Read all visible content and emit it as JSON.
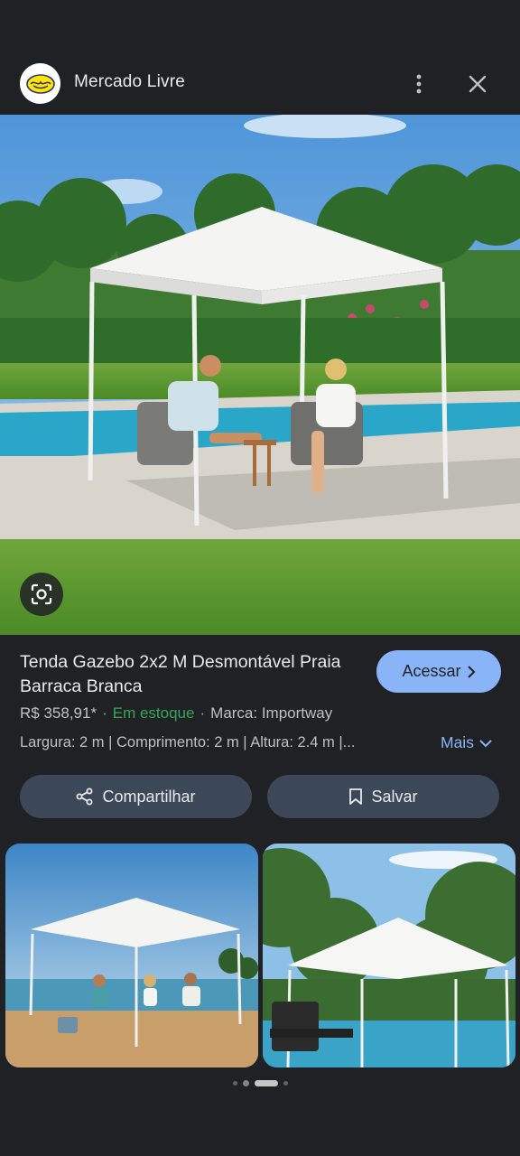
{
  "header": {
    "site_name": "Mercado Livre",
    "logo_icon": "mercado-livre-handshake-logo",
    "menu_icon": "more-vert-icon",
    "close_icon": "close-icon"
  },
  "hero": {
    "image": "white gazebo tent beside pool with two people seated",
    "lens_icon": "google-lens-icon"
  },
  "product": {
    "title": "Tenda Gazebo 2x2 M Desmontável Praia Barraca Branca",
    "price": "R$ 358,91*",
    "stock": "Em estoque",
    "brand": "Marca: Importway",
    "specs": "Largura: 2 m | Comprimento: 2 m | Altura: 2.4 m |...",
    "more_label": "Mais",
    "access_label": "Acessar"
  },
  "actions": {
    "share_label": "Compartilhar",
    "save_label": "Salvar"
  },
  "thumbnails": [
    {
      "alt": "gazebo on beach with people"
    },
    {
      "alt": "gazebo beside pool with grill"
    }
  ],
  "colors": {
    "background": "#1f2125",
    "accent": "#8ab4f8",
    "stock_green": "#34a853",
    "button_bg": "#3c4858"
  }
}
